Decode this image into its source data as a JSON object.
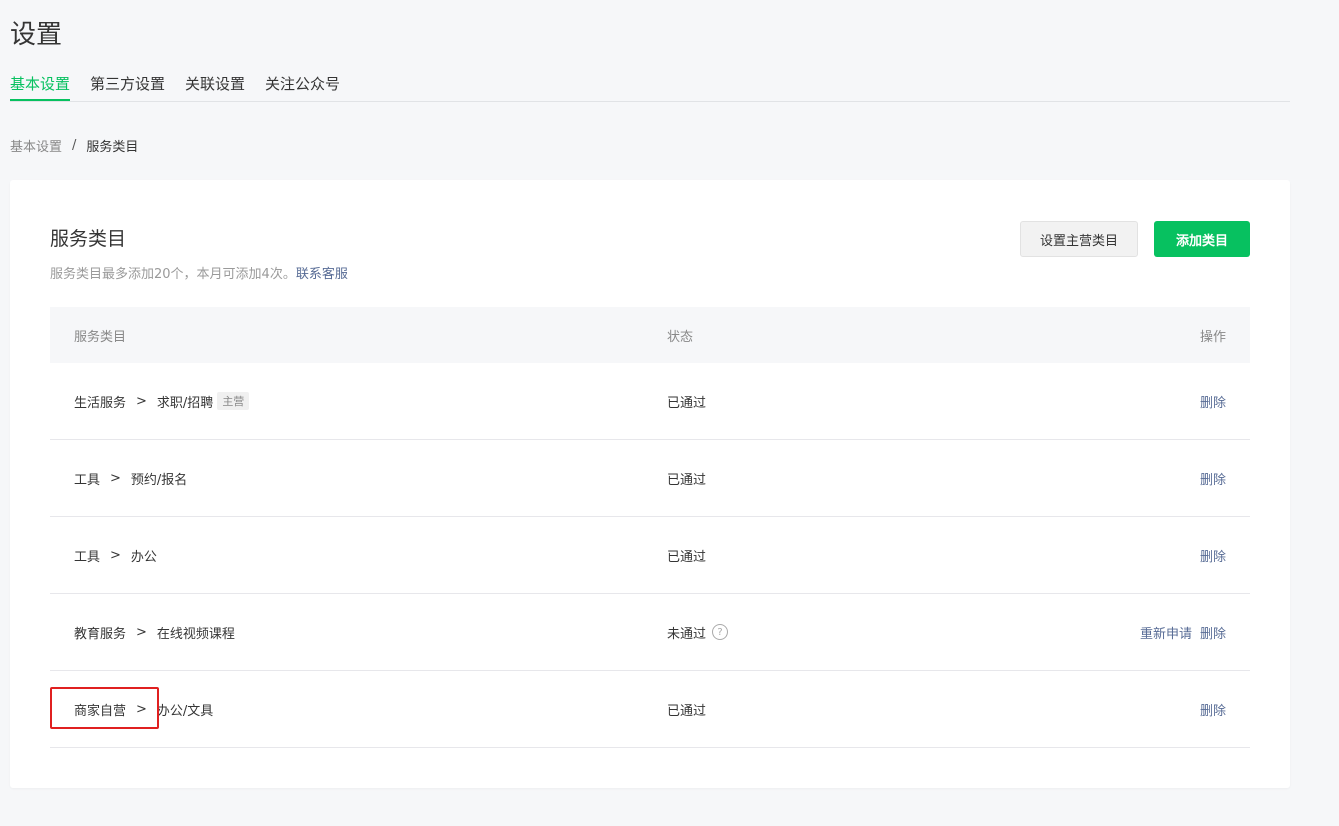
{
  "page_title": "设置",
  "tabs": [
    {
      "label": "基本设置"
    },
    {
      "label": "第三方设置"
    },
    {
      "label": "关联设置"
    },
    {
      "label": "关注公众号"
    }
  ],
  "active_tab_color": "#07c160",
  "breadcrumb": {
    "parent": "基本设置",
    "separator": "/",
    "current": "服务类目"
  },
  "card": {
    "title": "服务类目",
    "desc": "服务类目最多添加20个，本月可添加4次。",
    "contact_link": "联系客服",
    "btn_set_main": "设置主营类目",
    "btn_add": "添加类目"
  },
  "table": {
    "headers": {
      "category": "服务类目",
      "status": "状态",
      "ops": "操作"
    },
    "gt": ">",
    "rows": [
      {
        "cat1": "生活服务",
        "cat2": "求职/招聘",
        "tag": "主营",
        "status": "已通过",
        "reapply": "",
        "delete": "删除"
      },
      {
        "cat1": "工具",
        "cat2": "预约/报名",
        "tag": "",
        "status": "已通过",
        "reapply": "",
        "delete": "删除"
      },
      {
        "cat1": "工具",
        "cat2": "办公",
        "tag": "",
        "status": "已通过",
        "reapply": "",
        "delete": "删除"
      },
      {
        "cat1": "教育服务",
        "cat2": "在线视频课程",
        "tag": "",
        "status": "未通过",
        "reapply": "重新申请",
        "delete": "删除"
      },
      {
        "cat1": "商家自营",
        "cat2": "办公/文具",
        "tag": "",
        "status": "已通过",
        "reapply": "",
        "delete": "删除"
      }
    ]
  },
  "help_icon_glyph": "?",
  "highlight_color": "#e02020"
}
